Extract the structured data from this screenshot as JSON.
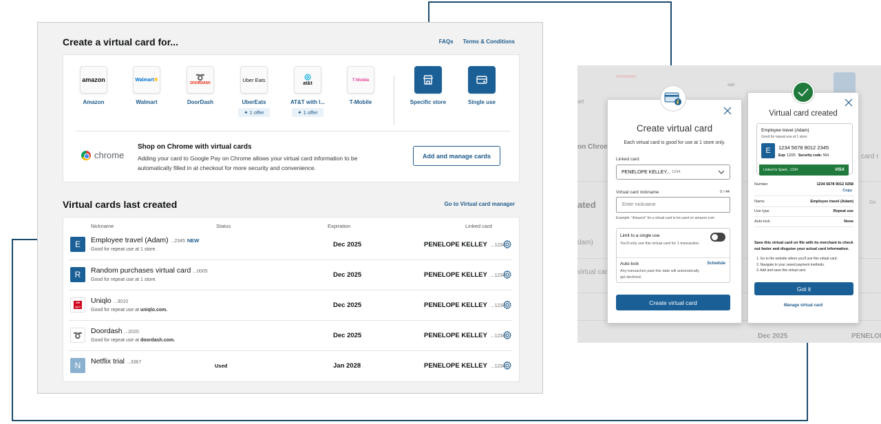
{
  "main": {
    "title": "Create a virtual card for...",
    "links": [
      "FAQs",
      "Terms & Conditions"
    ],
    "stores": [
      {
        "label": "Amazon",
        "logo": "amazon",
        "offer": ""
      },
      {
        "label": "Walmart",
        "logo": "Walmart",
        "offer": ""
      },
      {
        "label": "DoorDash",
        "logo": "DOORDASH",
        "offer": ""
      },
      {
        "label": "UberEats",
        "logo": "Uber Eats",
        "offer": "1 offer"
      },
      {
        "label": "AT&T with l...",
        "logo": "at&t",
        "offer": "1 offer"
      },
      {
        "label": "T-Mobile",
        "logo": "T-Mobile",
        "offer": ""
      }
    ],
    "specific_store": "Specific store",
    "single_use": "Single use",
    "chrome_word": "chrome",
    "shop_title": "Shop on Chrome with virtual cards",
    "shop_desc": "Adding your card to Google Pay on Chrome allows your virtual card information to be automatically filled in at checkout for more security and convenience.",
    "add_manage": "Add and manage cards"
  },
  "last": {
    "title": "Virtual cards last created",
    "manager_link": "Go to Virtual card manager",
    "headers": {
      "nickname": "Nickname",
      "status": "Status",
      "expiration": "Expiration",
      "linked": "Linked card"
    },
    "rows": [
      {
        "avatar": "E",
        "name": "Employee travel (Adam)",
        "suffix": "...2345",
        "badge": "NEW",
        "sub": "Good for repeat use at 1 store.",
        "sub_bold": "",
        "status": "",
        "exp": "Dec 2025",
        "linked": "PENELOPE KELLEY",
        "linked_suffix": "...1234"
      },
      {
        "avatar": "R",
        "name": "Random purchases virtual card",
        "suffix": "...0005",
        "badge": "",
        "sub": "Good for repeat use at 1 store.",
        "sub_bold": "",
        "status": "",
        "exp": "Dec 2025",
        "linked": "PENELOPE KELLEY",
        "linked_suffix": "...1234"
      },
      {
        "avatar": "",
        "name": "Uniqlo",
        "suffix": "...3010",
        "badge": "",
        "sub": "Good for repeat use at ",
        "sub_bold": "uniqlo.com.",
        "status": "",
        "exp": "Dec 2025",
        "linked": "PENELOPE KELLEY",
        "linked_suffix": "...1234"
      },
      {
        "avatar": "",
        "name": "Doordash",
        "suffix": "...2020",
        "badge": "",
        "sub": "Good for repeat use at ",
        "sub_bold": "doordash.com.",
        "status": "",
        "exp": "Dec 2025",
        "linked": "PENELOPE KELLEY",
        "linked_suffix": "...1234"
      },
      {
        "avatar": "N",
        "name": "Netflix trial",
        "suffix": "...3367",
        "badge": "",
        "sub": "",
        "sub_bold": "",
        "status": "Used",
        "exp": "Jan 2028",
        "linked": "PENELOPE KELLEY",
        "linked_suffix": "...1234"
      }
    ]
  },
  "bg": {
    "on_chrom": "on Chrom",
    "art": "art",
    "card_r": "card r",
    "ated": "ated",
    "g": "Go",
    "adam": "dam)",
    "virtual_card": "virtual card",
    "dec": "Dec 2025",
    "penelop": "PENELOP",
    "doordash": "DOORDASH",
    "att": "at&t"
  },
  "create_modal": {
    "title": "Create virtual card",
    "sub": "Each virtual card is good for use at 1 store only.",
    "linked_label": "Linked card",
    "linked_value": "PENELOPE KELLEY...",
    "linked_suffix": "1234",
    "nickname_label": "Virtual card nickname",
    "nickname_count": "0 / 44",
    "nickname_placeholder": "Enter nickname",
    "nickname_hint": "Example: \"Amazon\" for a virtual card to be used on amazon.com",
    "limit_title": "Limit to a single use",
    "limit_desc": "You'll only use this virtual card for 1 transaction.",
    "autolock_title": "Auto-lock",
    "autolock_link": "Schedule",
    "autolock_desc": "Any transaction past this date will automatically get declined.",
    "submit": "Create virtual card"
  },
  "created_modal": {
    "title": "Virtual card created",
    "card_name": "Employee travel (Adam)",
    "card_sub": "Good for repeat use at 1 store",
    "card_avatar": "E",
    "card_number": "1234 5678 9012 2345",
    "card_exp_label": "Exp:",
    "card_exp": "12/25",
    "card_sec_label": "Security code:",
    "card_sec": "564",
    "linked_strip": "Linked to Spark...1234",
    "visa": "VISA",
    "fields": [
      {
        "k": "Number",
        "v": "1234 5678 9012 0258"
      },
      {
        "k": "Name",
        "v": "Employee travel (Adam)"
      },
      {
        "k": "Use type",
        "v": "Repeat use"
      },
      {
        "k": "Auto-lock",
        "v": "None"
      }
    ],
    "copy": "Copy",
    "save_text": "Save this virtual card on file with its merchant to check out faster and disguise your actual card information.",
    "steps": [
      "1. Go to the website where you'll use this virtual card.",
      "2. Navigate to your saved payment methods.",
      "3. Add and save this virtual card."
    ],
    "got_it": "Got it",
    "manage": "Manage virtual card"
  },
  "colors": {
    "primary": "#1a5f96",
    "link": "#1e5a8a",
    "success": "#1f7a3c"
  }
}
